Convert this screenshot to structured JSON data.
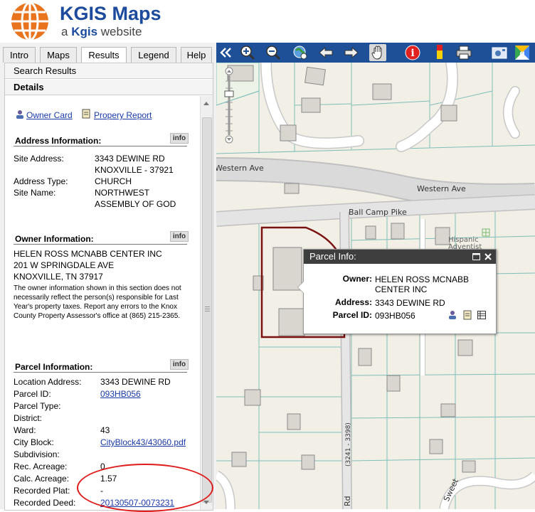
{
  "header": {
    "title": "KGIS Maps",
    "subtitle_prefix": "a",
    "subtitle_brand": "Kgis",
    "subtitle_suffix": "website"
  },
  "tabs": [
    "Intro",
    "Maps",
    "Results",
    "Legend",
    "Help"
  ],
  "active_tab": "Results",
  "panel": {
    "search_results_label": "Search Results",
    "details_label": "Details",
    "owner_card_link": "Owner Card",
    "property_report_link": "Propery Report"
  },
  "address_info": {
    "title": "Address Information:",
    "info_btn": "info",
    "rows": [
      {
        "label": "Site Address:",
        "value": "3343 DEWINE RD"
      },
      {
        "label": "",
        "value": "KNOXVILLE - 37921"
      },
      {
        "label": "Address Type:",
        "value": "CHURCH"
      },
      {
        "label": "Site Name:",
        "value": "NORTHWEST"
      },
      {
        "label": "",
        "value": "ASSEMBLY OF GOD"
      }
    ]
  },
  "owner_info": {
    "title": "Owner Information:",
    "info_btn": "info",
    "lines": [
      "HELEN ROSS MCNABB CENTER INC",
      "201 W SPRINGDALE AVE",
      "KNOXVILLE, TN 37917"
    ],
    "note": "The owner information shown in this section does not necessarily reflect the person(s) responsible for Last Year's property taxes. Report any errors to the Knox County Property Assessor's office at (865) 215-2365."
  },
  "parcel_info": {
    "title": "Parcel Information:",
    "info_btn": "info",
    "rows": [
      {
        "label": "Location Address:",
        "value": "3343 DEWINE RD",
        "link": false
      },
      {
        "label": "Parcel ID:",
        "value": "093HB056",
        "link": true
      },
      {
        "label": "Parcel Type:",
        "value": "",
        "link": false
      },
      {
        "label": "District:",
        "value": "",
        "link": false
      },
      {
        "label": "Ward:",
        "value": "43",
        "link": false
      },
      {
        "label": "City Block:",
        "value": "CityBlock43/43060.pdf",
        "link": true
      },
      {
        "label": "Subdivision:",
        "value": "",
        "link": false
      },
      {
        "label": "Rec. Acreage:",
        "value": "0",
        "link": false
      },
      {
        "label": "Calc. Acreage:",
        "value": "1.57",
        "link": false
      },
      {
        "label": "Recorded Plat:",
        "value": "-",
        "link": false
      },
      {
        "label": "Recorded Deed:",
        "value": "20130507-0073231",
        "link": true
      }
    ]
  },
  "toolbar": {
    "icons": [
      "collapse-icon",
      "zoom-in-icon",
      "zoom-out-icon",
      "full-extent-icon",
      "back-icon",
      "forward-icon",
      "pan-icon",
      "identify-icon",
      "highlight-icon",
      "print-icon",
      "photo-icon",
      "google-maps-icon"
    ],
    "active": "pan-icon"
  },
  "map": {
    "street_labels": [
      "Western Ave",
      "Western Ave",
      "Ball Camp Pike",
      "(3241 - 3398)",
      "Rd",
      "Sweet",
      "Hispanic",
      "Adventist"
    ],
    "colors": {
      "road": "#c8c8c8",
      "parcel": "#7fbfb8",
      "selected_parcel": "#7a1212",
      "building": "#d4d4cc"
    }
  },
  "popup": {
    "title": "Parcel Info:",
    "owner_label": "Owner:",
    "owner_value_1": "HELEN ROSS MCNABB",
    "owner_value_2": "CENTER INC",
    "address_label": "Address:",
    "address_value": "3343 DEWINE RD",
    "parcel_label": "Parcel ID:",
    "parcel_value": "093HB056"
  }
}
